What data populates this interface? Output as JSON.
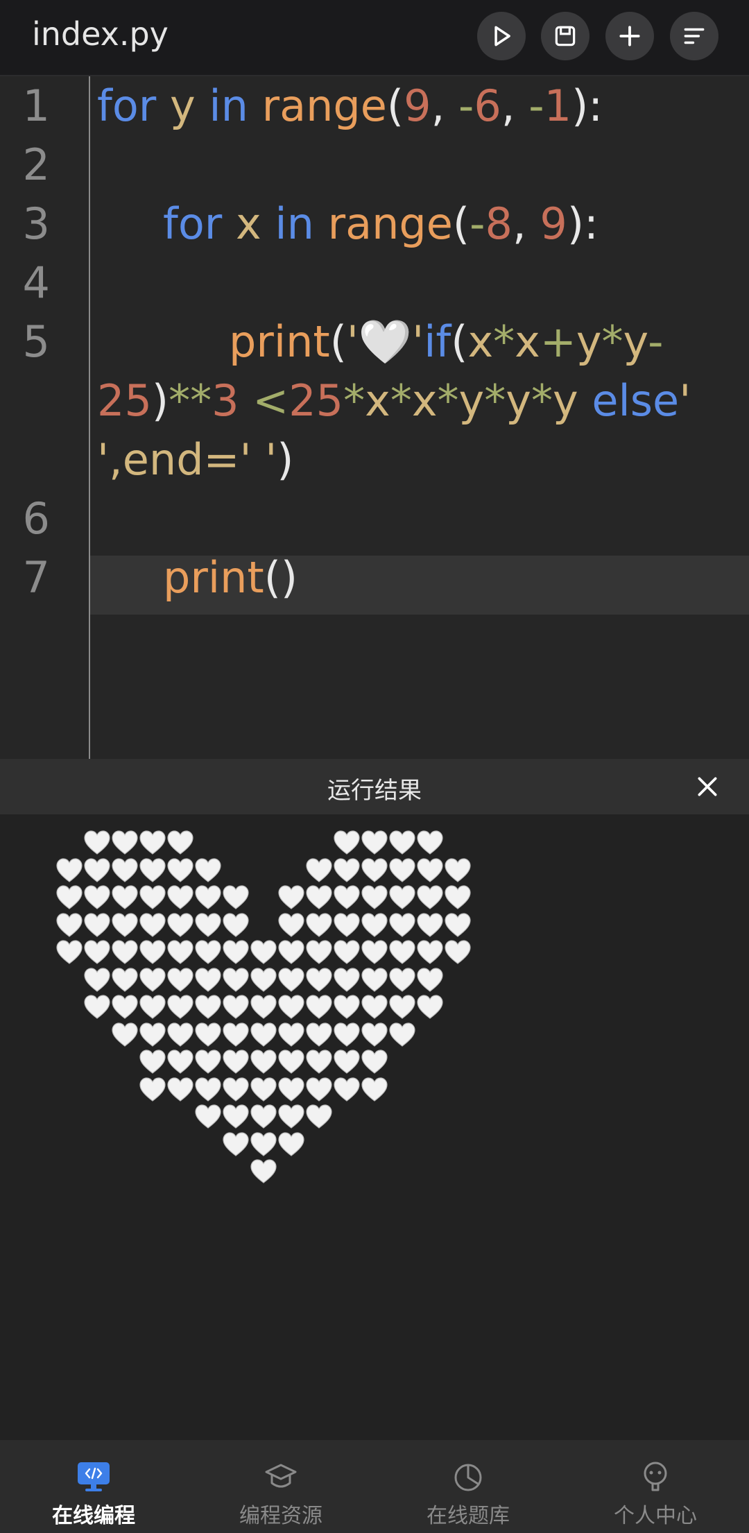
{
  "header": {
    "file_name": "index.py",
    "buttons": [
      "run-icon",
      "save-icon",
      "add-icon",
      "format-icon"
    ]
  },
  "editor": {
    "line_numbers": [
      "1",
      "2",
      "3",
      "4",
      "5",
      "6",
      "7"
    ],
    "code": {
      "l1": [
        [
          "kw",
          "for"
        ],
        [
          "pn",
          " "
        ],
        [
          "var",
          "y"
        ],
        [
          "pn",
          " "
        ],
        [
          "kw",
          "in"
        ],
        [
          "pn",
          " "
        ],
        [
          "fn",
          "range"
        ],
        [
          "pn",
          "("
        ],
        [
          "num",
          "9"
        ],
        [
          "pn",
          ", "
        ],
        [
          "op",
          "-"
        ],
        [
          "num",
          "6"
        ],
        [
          "pn",
          ", "
        ],
        [
          "op",
          "-"
        ],
        [
          "num",
          "1"
        ],
        [
          "pn",
          "):"
        ]
      ],
      "l3": [
        [
          "kw",
          "for"
        ],
        [
          "pn",
          " "
        ],
        [
          "var",
          "x"
        ],
        [
          "pn",
          " "
        ],
        [
          "kw",
          "in"
        ],
        [
          "pn",
          " "
        ],
        [
          "fn",
          "range"
        ],
        [
          "pn",
          "("
        ],
        [
          "op",
          "-"
        ],
        [
          "num",
          "8"
        ],
        [
          "pn",
          ", "
        ],
        [
          "num",
          "9"
        ],
        [
          "pn",
          "):"
        ]
      ],
      "l5a": [
        [
          "fn",
          "print"
        ],
        [
          "pn",
          "("
        ],
        [
          "str",
          "'🤍'"
        ],
        [
          "kw",
          "if"
        ],
        [
          "pn",
          "("
        ],
        [
          "var",
          "x"
        ],
        [
          "op",
          "*"
        ],
        [
          "var",
          "x"
        ],
        [
          "op",
          "+"
        ],
        [
          "var",
          "y"
        ],
        [
          "op",
          "*"
        ],
        [
          "var",
          "y"
        ],
        [
          "op",
          "-"
        ]
      ],
      "l5b": [
        [
          "num",
          "25"
        ],
        [
          "pn",
          ")"
        ],
        [
          "op",
          "**"
        ],
        [
          "num",
          "3"
        ],
        [
          "pn",
          " "
        ],
        [
          "op",
          "<"
        ],
        [
          "num",
          "25"
        ],
        [
          "op",
          "*"
        ],
        [
          "var",
          "x"
        ],
        [
          "op",
          "*"
        ],
        [
          "var",
          "x"
        ],
        [
          "op",
          "*"
        ],
        [
          "var",
          "y"
        ],
        [
          "op",
          "*"
        ],
        [
          "var",
          "y"
        ],
        [
          "op",
          "*"
        ],
        [
          "var",
          "y"
        ],
        [
          "pn",
          " "
        ],
        [
          "kw",
          "else"
        ],
        [
          "str",
          "'"
        ]
      ],
      "l5c": [
        [
          "str",
          "',end=' '"
        ],
        [
          "pn",
          ")"
        ]
      ],
      "l7": [
        [
          "fn",
          "print"
        ],
        [
          "pn",
          "()"
        ]
      ]
    }
  },
  "result_panel": {
    "title": "运行结果",
    "heart_glyph": "🤍",
    "heart_color": "#f2f2f2",
    "rows": [
      "  ####     ####  ",
      " ######   ###### ",
      " ####### ####### ",
      " ####### ####### ",
      " ############### ",
      "  #############  ",
      "  #############  ",
      "   ###########   ",
      "    #########    ",
      "    #########    ",
      "      #####      ",
      "       ###       ",
      "        #        "
    ]
  },
  "nav": {
    "items": [
      {
        "label": "在线编程",
        "icon": "code-monitor-icon",
        "active": true
      },
      {
        "label": "编程资源",
        "icon": "graduation-cap-icon",
        "active": false
      },
      {
        "label": "在线题库",
        "icon": "pie-chart-icon",
        "active": false
      },
      {
        "label": "个人中心",
        "icon": "user-icon",
        "active": false
      }
    ],
    "active_color": "#3d7fe8"
  }
}
